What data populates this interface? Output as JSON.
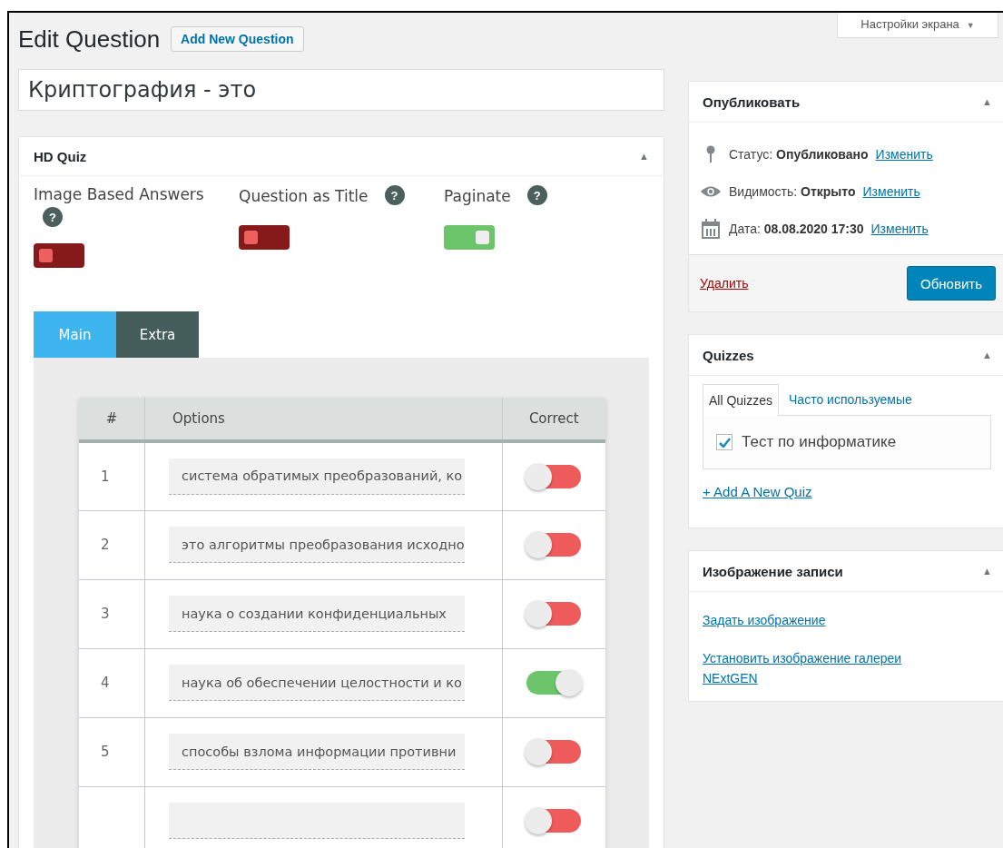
{
  "screen_options": {
    "label": "Настройки экрана",
    "caret": "▼"
  },
  "header": {
    "title": "Edit Question",
    "add_button": "Add New Question"
  },
  "question_title": {
    "value": "Криптография - это"
  },
  "hd_quiz": {
    "title": "HD Quiz",
    "collapse": "▲",
    "settings": [
      {
        "label": "Image Based Answers",
        "help": "?",
        "on": false
      },
      {
        "label": "Question as Title",
        "help": "?",
        "on": false
      },
      {
        "label": "Paginate",
        "help": "?",
        "on": true
      }
    ],
    "tabs": [
      {
        "label": "Main",
        "selected": true
      },
      {
        "label": "Extra",
        "selected": false
      }
    ],
    "table": {
      "columns": [
        "#",
        "Options",
        "Correct"
      ],
      "rows": [
        {
          "number": "1",
          "option": "система обратимых преобразований, ко",
          "correct": false
        },
        {
          "number": "2",
          "option": "это алгоритмы преобразования исходно",
          "correct": false
        },
        {
          "number": "3",
          "option": "наука о создании конфиденциальных",
          "correct": false
        },
        {
          "number": "4",
          "option": "наука об обеспечении целостности и ко",
          "correct": true
        },
        {
          "number": "5",
          "option": "способы взлома информации противни",
          "correct": false
        },
        {
          "correct": false
        }
      ]
    }
  },
  "publish": {
    "title": "Опубликовать",
    "collapse": "▲",
    "items": [
      {
        "kind": "status",
        "label": "Статус:",
        "value": "Опубликовано",
        "link": "Изменить"
      },
      {
        "kind": "visibility",
        "label": "Видимость:",
        "value": "Открыто",
        "link": "Изменить"
      },
      {
        "kind": "date",
        "label": "Дата:",
        "value": "08.08.2020 17:30",
        "link": "Изменить"
      }
    ],
    "delete": "Удалить",
    "update": "Обновить"
  },
  "quizzes": {
    "title": "Quizzes",
    "collapse": "▲",
    "tabs": [
      {
        "label": "All Quizzes",
        "selected": true
      },
      {
        "label": "Часто используемые",
        "selected": false
      }
    ],
    "items": [
      {
        "label": "Тест по информатике",
        "checked": true
      }
    ],
    "add_link": "+ Add A New Quiz"
  },
  "featured_image": {
    "title": "Изображение записи",
    "collapse": "▲",
    "links": [
      "Задать изображение",
      "Установить изображение галереи NExtGEN"
    ]
  }
}
